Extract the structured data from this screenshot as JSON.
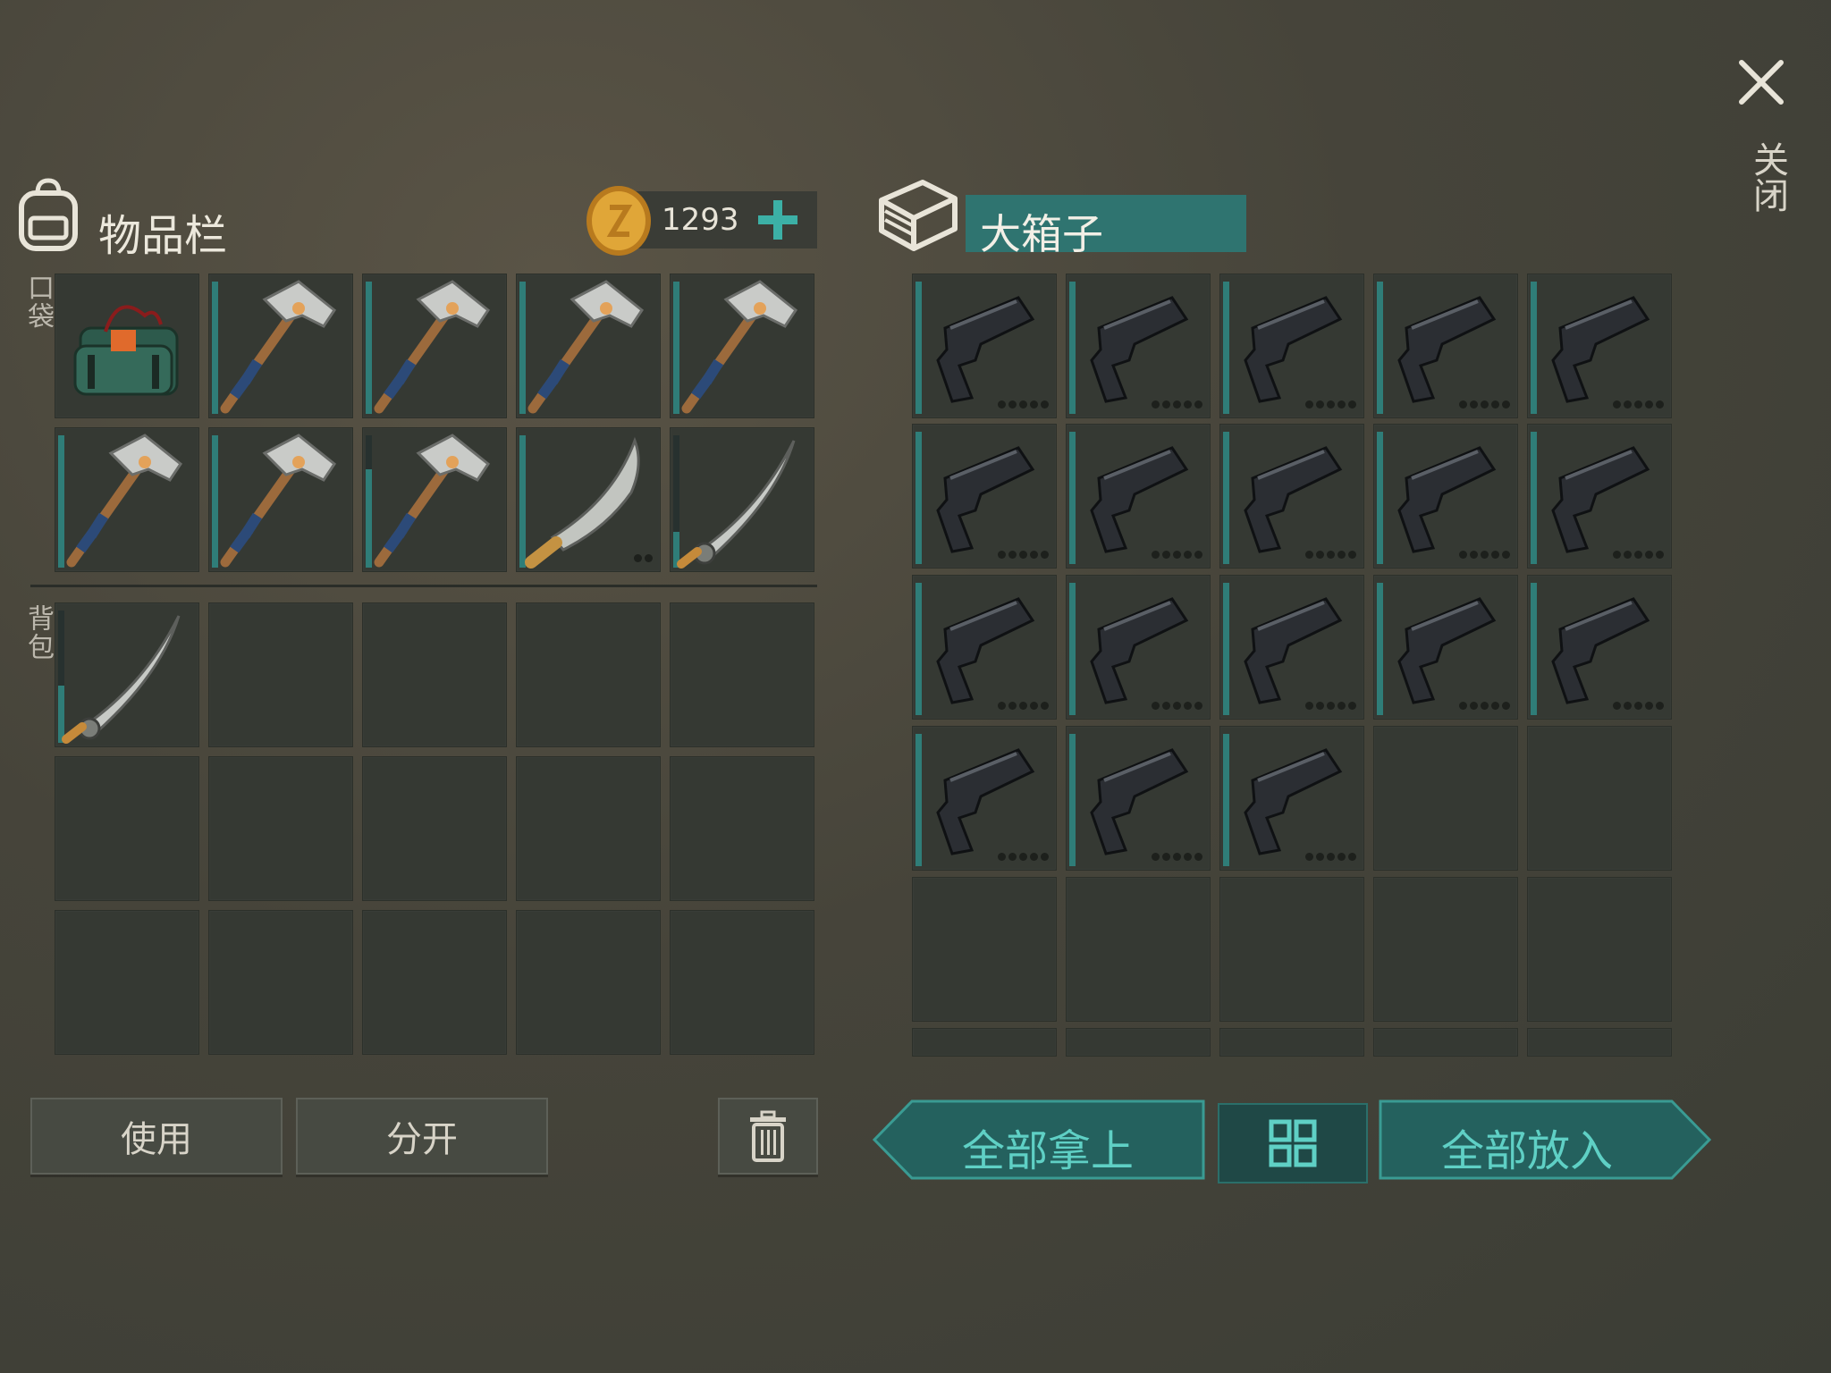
{
  "inventory": {
    "title": "物品栏",
    "coins": "1293",
    "pocket_label": "口袋",
    "backpack_label": "背包",
    "pocket_items": [
      "c4-explosive",
      "hatchet",
      "hatchet",
      "hatchet",
      "hatchet",
      "hatchet",
      "hatchet",
      "hatchet",
      "machete",
      "katana"
    ],
    "backpack_items": [
      "katana"
    ]
  },
  "container": {
    "title": "大箱子",
    "items": [
      "pistol",
      "pistol",
      "pistol",
      "pistol",
      "pistol",
      "pistol",
      "pistol",
      "pistol",
      "pistol",
      "pistol",
      "pistol",
      "pistol",
      "pistol",
      "pistol",
      "pistol",
      "pistol",
      "pistol",
      "pistol"
    ]
  },
  "buttons": {
    "use": "使用",
    "split": "分开",
    "take_all": "全部拿上",
    "put_all": "全部放入",
    "close": "关闭"
  },
  "icons": {
    "backpack": "backpack-icon",
    "coin": "coin-icon",
    "add": "plus-icon",
    "box": "box-icon",
    "close": "close-icon",
    "trash": "trash-icon",
    "sort": "grid-sort-icon"
  },
  "colors": {
    "accent": "#2f7d78",
    "teal_text": "#5fd0c5",
    "coin": "#d99a2a"
  }
}
